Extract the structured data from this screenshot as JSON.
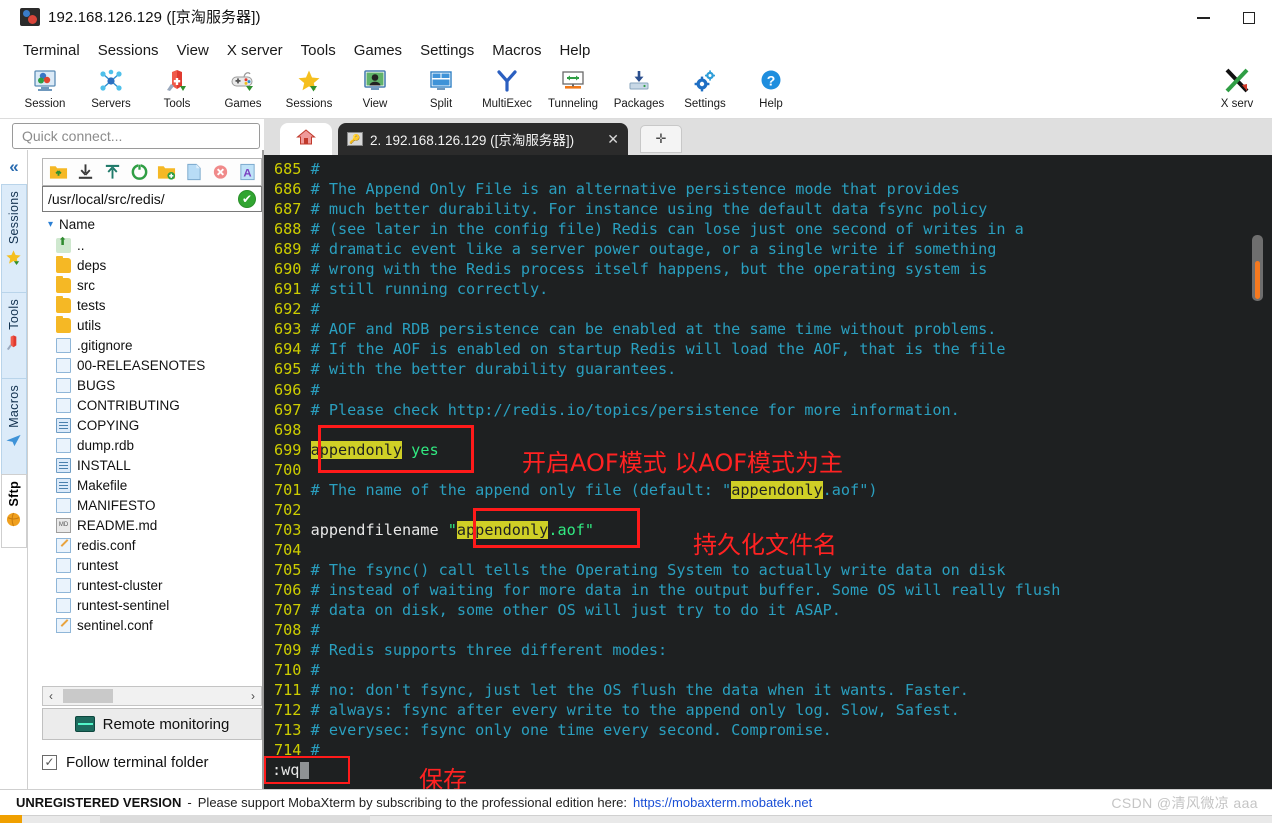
{
  "window": {
    "title": "192.168.126.129 ([京淘服务器])",
    "app_icon": "mobaxterm-icon",
    "minimize_label": "minimize",
    "maximize_label": "maximize"
  },
  "menubar": {
    "items": [
      {
        "label": "Terminal"
      },
      {
        "label": "Sessions"
      },
      {
        "label": "View"
      },
      {
        "label": "X server"
      },
      {
        "label": "Tools"
      },
      {
        "label": "Games"
      },
      {
        "label": "Settings"
      },
      {
        "label": "Macros"
      },
      {
        "label": "Help"
      }
    ]
  },
  "toolbar": {
    "items": [
      {
        "label": "Session",
        "icon": "session-icon"
      },
      {
        "label": "Servers",
        "icon": "servers-icon"
      },
      {
        "label": "Tools",
        "icon": "tools-icon"
      },
      {
        "label": "Games",
        "icon": "games-icon"
      },
      {
        "label": "Sessions",
        "icon": "sessions-star-icon"
      },
      {
        "label": "View",
        "icon": "view-icon"
      },
      {
        "label": "Split",
        "icon": "split-icon"
      },
      {
        "label": "MultiExec",
        "icon": "multiexec-icon"
      },
      {
        "label": "Tunneling",
        "icon": "tunneling-icon"
      },
      {
        "label": "Packages",
        "icon": "packages-icon"
      },
      {
        "label": "Settings",
        "icon": "settings-gear-icon"
      },
      {
        "label": "Help",
        "icon": "help-icon"
      }
    ],
    "xserver": {
      "label": "X serv",
      "icon": "x-server-icon"
    }
  },
  "quick_connect": {
    "placeholder": "Quick connect...",
    "value": ""
  },
  "vertical_tabs": {
    "collapse_glyph": "«",
    "items": [
      {
        "label": "Sessions",
        "icon": "star-icon",
        "active": false
      },
      {
        "label": "Tools",
        "icon": "wrench-icon",
        "active": false
      },
      {
        "label": "Macros",
        "icon": "paper-plane-icon",
        "active": false
      },
      {
        "label": "Sftp",
        "icon": "globe-icon",
        "active": true
      }
    ]
  },
  "sftp": {
    "toolbar_icons": [
      "parent-folder-icon",
      "download-icon",
      "upload-icon",
      "refresh-icon",
      "new-folder-icon",
      "new-file-icon",
      "delete-icon",
      "text-mode-icon"
    ],
    "path": "/usr/local/src/redis/",
    "path_status": "✔",
    "column_header": "Name",
    "sort_caret": "▾",
    "files": [
      {
        "name": "..",
        "type": "parent"
      },
      {
        "name": "deps",
        "type": "folder"
      },
      {
        "name": "src",
        "type": "folder"
      },
      {
        "name": "tests",
        "type": "folder"
      },
      {
        "name": "utils",
        "type": "folder"
      },
      {
        "name": ".gitignore",
        "type": "file"
      },
      {
        "name": "00-RELEASENOTES",
        "type": "file"
      },
      {
        "name": "BUGS",
        "type": "file"
      },
      {
        "name": "CONTRIBUTING",
        "type": "file"
      },
      {
        "name": "COPYING",
        "type": "textfile"
      },
      {
        "name": "dump.rdb",
        "type": "file"
      },
      {
        "name": "INSTALL",
        "type": "textfile"
      },
      {
        "name": "Makefile",
        "type": "textfile"
      },
      {
        "name": "MANIFESTO",
        "type": "file"
      },
      {
        "name": "README.md",
        "type": "md"
      },
      {
        "name": "redis.conf",
        "type": "conf"
      },
      {
        "name": "runtest",
        "type": "file"
      },
      {
        "name": "runtest-cluster",
        "type": "file"
      },
      {
        "name": "runtest-sentinel",
        "type": "file"
      },
      {
        "name": "sentinel.conf",
        "type": "conf"
      }
    ],
    "hscroll": {
      "left_arrow": "‹",
      "right_arrow": "›"
    },
    "remote_monitoring": "Remote monitoring",
    "follow_terminal_folder": {
      "label": "Follow terminal folder",
      "checked": true,
      "check_glyph": "✓"
    }
  },
  "tabbar": {
    "home_icon": "home-icon",
    "session_tab": {
      "icon": "key-icon",
      "title": "2. 192.168.126.129 ([京淘服务器])",
      "close_glyph": "✕"
    },
    "add_tab_glyph": "✛"
  },
  "terminal": {
    "file": "redis.conf",
    "lines": [
      {
        "num": "685",
        "parts": [
          {
            "t": "#",
            "c": "cmt"
          }
        ]
      },
      {
        "num": "686",
        "parts": [
          {
            "t": "# The Append Only File is an alternative persistence mode that provides",
            "c": "cmt"
          }
        ]
      },
      {
        "num": "687",
        "parts": [
          {
            "t": "# much better durability. For instance using the default data fsync policy",
            "c": "cmt"
          }
        ]
      },
      {
        "num": "688",
        "parts": [
          {
            "t": "# (see later in the config file) Redis can lose just one second of writes in a",
            "c": "cmt"
          }
        ]
      },
      {
        "num": "689",
        "parts": [
          {
            "t": "# dramatic event like a server power outage, or a single write if something",
            "c": "cmt"
          }
        ]
      },
      {
        "num": "690",
        "parts": [
          {
            "t": "# wrong with the Redis process itself happens, but the operating system is",
            "c": "cmt"
          }
        ]
      },
      {
        "num": "691",
        "parts": [
          {
            "t": "# still running correctly.",
            "c": "cmt"
          }
        ]
      },
      {
        "num": "692",
        "parts": [
          {
            "t": "#",
            "c": "cmt"
          }
        ]
      },
      {
        "num": "693",
        "parts": [
          {
            "t": "# AOF and RDB persistence can be enabled at the same time without problems.",
            "c": "cmt"
          }
        ]
      },
      {
        "num": "694",
        "parts": [
          {
            "t": "# If the AOF is enabled on startup Redis will load the AOF, that is the file",
            "c": "cmt"
          }
        ]
      },
      {
        "num": "695",
        "parts": [
          {
            "t": "# with the better durability guarantees.",
            "c": "cmt"
          }
        ]
      },
      {
        "num": "696",
        "parts": [
          {
            "t": "#",
            "c": "cmt"
          }
        ]
      },
      {
        "num": "697",
        "parts": [
          {
            "t": "# Please check http://redis.io/topics/persistence for more information.",
            "c": "cmt"
          }
        ]
      },
      {
        "num": "698",
        "parts": []
      },
      {
        "num": "699",
        "parts": [
          {
            "t": "appendonly",
            "c": "hl"
          },
          {
            "t": " ",
            "c": "white"
          },
          {
            "t": "yes",
            "c": "green"
          }
        ]
      },
      {
        "num": "700",
        "parts": []
      },
      {
        "num": "701",
        "parts": [
          {
            "t": "# The name of the append only file (default: \"",
            "c": "cmt"
          },
          {
            "t": "appendonly",
            "c": "hl"
          },
          {
            "t": ".aof\")",
            "c": "cmt"
          }
        ]
      },
      {
        "num": "702",
        "parts": []
      },
      {
        "num": "703",
        "parts": [
          {
            "t": "appendfilename ",
            "c": "white"
          },
          {
            "t": "\"",
            "c": "green"
          },
          {
            "t": "appendonly",
            "c": "hl"
          },
          {
            "t": ".aof\"",
            "c": "green"
          }
        ]
      },
      {
        "num": "704",
        "parts": []
      },
      {
        "num": "705",
        "parts": [
          {
            "t": "# The fsync() call tells the Operating System to actually write data on disk",
            "c": "cmt"
          }
        ]
      },
      {
        "num": "706",
        "parts": [
          {
            "t": "# instead of waiting for more data in the output buffer. Some OS will really flush",
            "c": "cmt"
          }
        ]
      },
      {
        "num": "707",
        "parts": [
          {
            "t": "# data on disk, some other OS will just try to do it ASAP.",
            "c": "cmt"
          }
        ]
      },
      {
        "num": "708",
        "parts": [
          {
            "t": "#",
            "c": "cmt"
          }
        ]
      },
      {
        "num": "709",
        "parts": [
          {
            "t": "# Redis supports three different modes:",
            "c": "cmt"
          }
        ]
      },
      {
        "num": "710",
        "parts": [
          {
            "t": "#",
            "c": "cmt"
          }
        ]
      },
      {
        "num": "711",
        "parts": [
          {
            "t": "# no: don't fsync, just let the OS flush the data when it wants. Faster.",
            "c": "cmt"
          }
        ]
      },
      {
        "num": "712",
        "parts": [
          {
            "t": "# always: fsync after every write to the append only log. Slow, Safest.",
            "c": "cmt"
          }
        ]
      },
      {
        "num": "713",
        "parts": [
          {
            "t": "# everysec: fsync only one time every second. Compromise.",
            "c": "cmt"
          }
        ]
      },
      {
        "num": "714",
        "parts": [
          {
            "t": "#",
            "c": "cmt"
          }
        ]
      }
    ],
    "command_line": ":wq"
  },
  "annotations": {
    "color": "#ff2222",
    "items": [
      {
        "name": "aof-mode-note",
        "text": "开启AOF模式 以AOF模式为主"
      },
      {
        "name": "persist-filename-note",
        "text": "持久化文件名"
      },
      {
        "name": "save-note",
        "text": "保存"
      }
    ]
  },
  "statusbar": {
    "unregistered": "UNREGISTERED VERSION",
    "separator": "-",
    "message": "Please support MobaXterm by subscribing to the professional edition here:",
    "link": "https://mobaxterm.mobatek.net"
  },
  "watermark": "CSDN @清风微凉 aaa"
}
